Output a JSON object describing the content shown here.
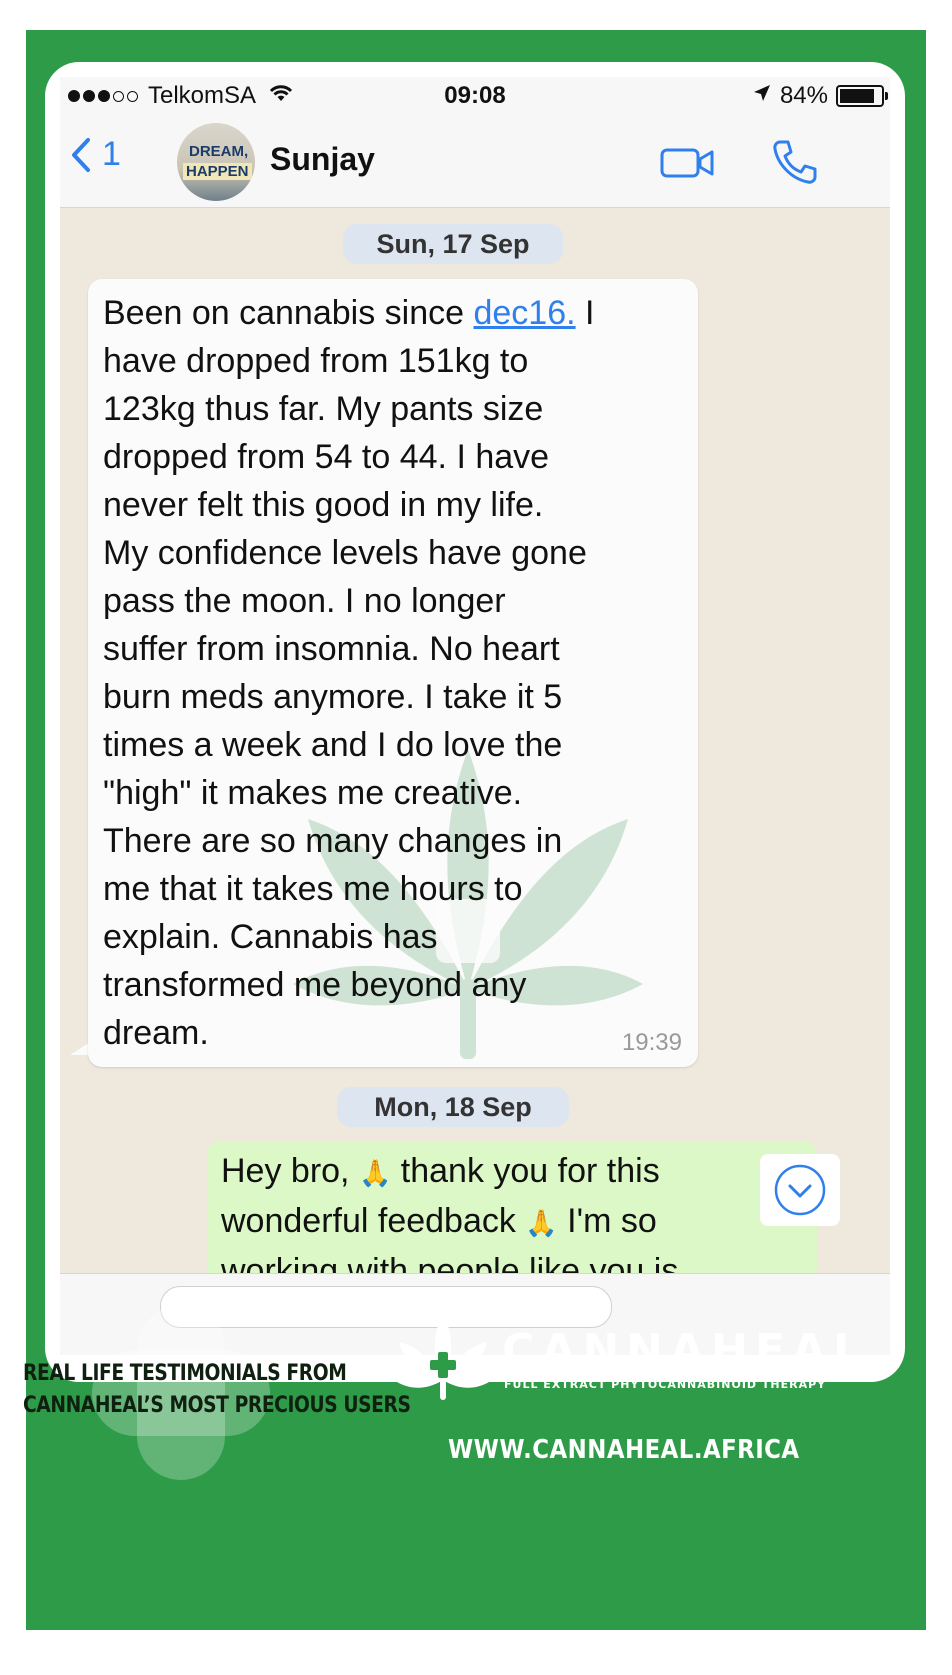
{
  "status_bar": {
    "carrier": "TelkomSA",
    "time": "09:08",
    "battery": "84%",
    "battery_level": 0.84,
    "signal_bars_filled": 3,
    "signal_bars_total": 5
  },
  "header": {
    "back_count": "1",
    "avatar_text_1": "DREAM,",
    "avatar_text_2": "HAPPEN",
    "contact_name": "Sunjay"
  },
  "chat": {
    "date_1": "Sun, 17 Sep",
    "incoming_message": {
      "first_line_before_link": "Been on cannabis since ",
      "link_text": "dec16.",
      "first_line_after_link": " I",
      "lines": [
        "have dropped from 151kg to",
        "123kg thus far. My pants size",
        "dropped from 54 to 44. I have",
        "never felt this good in my life.",
        "My confidence levels have gone",
        "pass the moon. I no longer",
        "suffer from insomnia. No heart",
        "burn meds anymore. I take it 5",
        "times a week and I do love the",
        "\"high\" it makes me creative.",
        "There are so many changes in",
        "me that it takes me hours to",
        "explain. Cannabis has",
        "transformed me beyond any",
        "dream."
      ],
      "time": "19:39"
    },
    "date_2": "Mon, 18 Sep",
    "outgoing_message": {
      "line_1_a": "Hey bro, ",
      "line_1_b": " thank you for this",
      "line_2_a": "wonderful feedback ",
      "line_2_b": " I'm so",
      "line_3": "working with people like you is"
    }
  },
  "footer": {
    "tagline_1": "REAL LIFE TESTIMONIALS FROM",
    "tagline_2": "CANNAHEAL’S MOST PRECIOUS USERS",
    "brand_name": "CANNAHEAL",
    "brand_sub": "FULL EXTRACT PHYTOCANNABINOID THERAPY",
    "website": "WWW.CANNAHEAL.AFRICA"
  },
  "colors": {
    "green": "#2e9b48",
    "ios_blue": "#2f80ed",
    "incoming_bubble": "#fbfbfb",
    "outgoing_bubble": "#dcf8c6"
  }
}
